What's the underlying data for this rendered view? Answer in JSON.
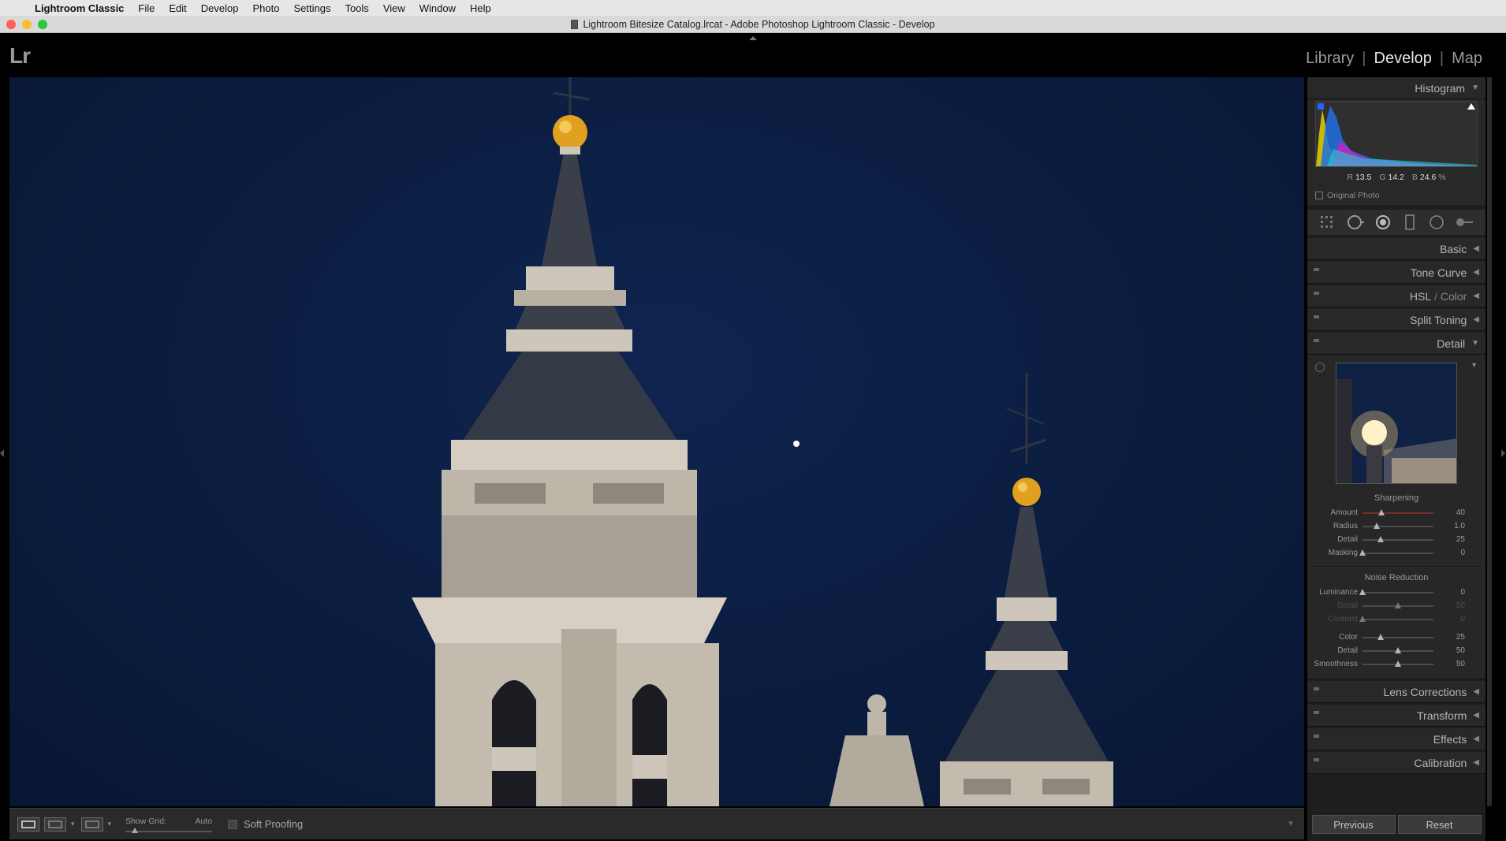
{
  "menubar": {
    "app_name": "Lightroom Classic",
    "items": [
      "File",
      "Edit",
      "Develop",
      "Photo",
      "Settings",
      "Tools",
      "View",
      "Window",
      "Help"
    ]
  },
  "window": {
    "title": "Lightroom Bitesize Catalog.lrcat - Adobe Photoshop Lightroom Classic - Develop"
  },
  "topbar": {
    "logo": "Lr",
    "modules": [
      "Library",
      "Develop",
      "Map"
    ],
    "active_module": "Develop"
  },
  "toolbar": {
    "show_grid_label": "Show Grid:",
    "show_grid_value": "Auto",
    "soft_proofing_label": "Soft Proofing"
  },
  "histogram": {
    "title": "Histogram",
    "r_label": "R",
    "r_value": "13.5",
    "g_label": "G",
    "g_value": "14.2",
    "b_label": "B",
    "b_value": "24.6",
    "unit": "%",
    "original_photo_label": "Original Photo"
  },
  "panels": {
    "basic": "Basic",
    "tone_curve": "Tone Curve",
    "hsl": "HSL",
    "hsl_sep": " / ",
    "color": "Color",
    "split_toning": "Split Toning",
    "detail": "Detail",
    "lens_corrections": "Lens Corrections",
    "transform": "Transform",
    "effects": "Effects",
    "calibration": "Calibration"
  },
  "detail": {
    "sharpening_title": "Sharpening",
    "sharpening": [
      {
        "label": "Amount",
        "value": "40",
        "fraction": 0.27
      },
      {
        "label": "Radius",
        "value": "1.0",
        "fraction": 0.2
      },
      {
        "label": "Detail",
        "value": "25",
        "fraction": 0.25
      },
      {
        "label": "Masking",
        "value": "0",
        "fraction": 0.0
      }
    ],
    "noise_title": "Noise Reduction",
    "noise_luminance": [
      {
        "label": "Luminance",
        "value": "0",
        "fraction": 0.0,
        "disabled": false
      },
      {
        "label": "Detail",
        "value": "50",
        "fraction": 0.5,
        "disabled": true
      },
      {
        "label": "Contrast",
        "value": "0",
        "fraction": 0.0,
        "disabled": true
      }
    ],
    "noise_color": [
      {
        "label": "Color",
        "value": "25",
        "fraction": 0.25,
        "disabled": false
      },
      {
        "label": "Detail",
        "value": "50",
        "fraction": 0.5,
        "disabled": false
      },
      {
        "label": "Smoothness",
        "value": "50",
        "fraction": 0.5,
        "disabled": false
      }
    ]
  },
  "buttons": {
    "previous": "Previous",
    "reset": "Reset"
  },
  "colors": {
    "sky": "#0b1d40",
    "stone": "#cfc6bb",
    "roof": "#3a3f4a",
    "gold": "#e0a020",
    "sharpen_fill": "#7a2b2b"
  }
}
